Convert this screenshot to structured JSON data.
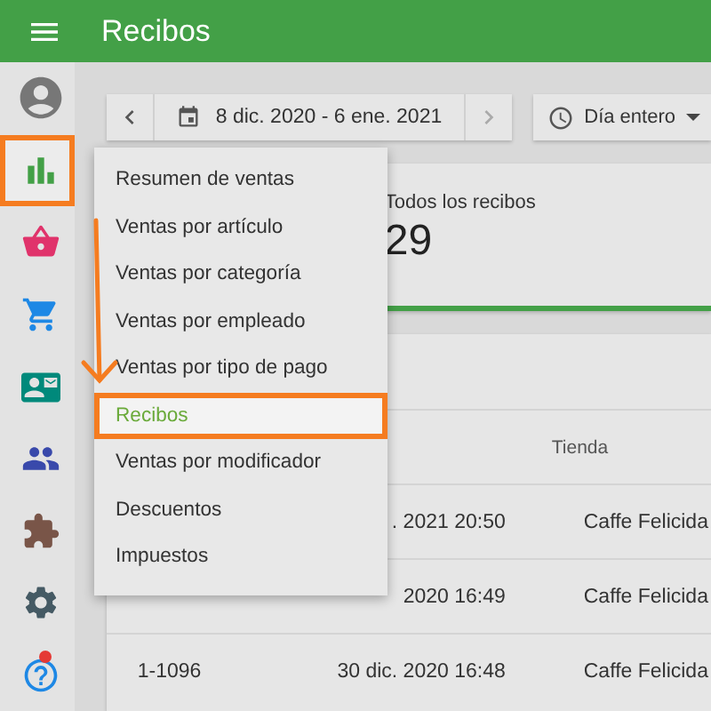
{
  "header": {
    "title": "Recibos"
  },
  "sidebar": {
    "items": [
      {
        "selected": false,
        "notification": false
      },
      {
        "selected": true,
        "notification": false
      },
      {
        "selected": false,
        "notification": false
      },
      {
        "selected": false,
        "notification": false
      },
      {
        "selected": false,
        "notification": false
      },
      {
        "selected": false,
        "notification": false
      },
      {
        "selected": false,
        "notification": false
      },
      {
        "selected": false,
        "notification": false
      },
      {
        "selected": false,
        "notification": true
      }
    ]
  },
  "filters": {
    "date_range": "8 dic. 2020 - 6 ene. 2021",
    "time": "Día entero"
  },
  "summary": {
    "label": "Todos los recibos",
    "value": "29"
  },
  "table": {
    "columns": [
      {
        "label": "Tienda"
      }
    ],
    "rows": [
      {
        "column_2": ". 2021 20:50",
        "column_3": "Caffe Felicida"
      },
      {
        "column_2": "2020 16:49",
        "column_3": "Caffe Felicida"
      },
      {
        "column_1": "1-1096",
        "column_2": "30 dic. 2020 16:48",
        "column_3": "Caffe Felicida"
      }
    ]
  },
  "menu": {
    "items": [
      {
        "label": "Resumen de ventas",
        "selected": false
      },
      {
        "label": "Ventas por artículo",
        "selected": false
      },
      {
        "label": "Ventas por categoría",
        "selected": false
      },
      {
        "label": "Ventas por empleado",
        "selected": false
      },
      {
        "label": "Ventas por tipo de pago",
        "selected": false
      },
      {
        "label": "Recibos",
        "selected": true
      },
      {
        "label": "Ventas por modificador",
        "selected": false
      },
      {
        "label": "Descuentos",
        "selected": false
      },
      {
        "label": "Impuestos",
        "selected": false
      }
    ]
  }
}
